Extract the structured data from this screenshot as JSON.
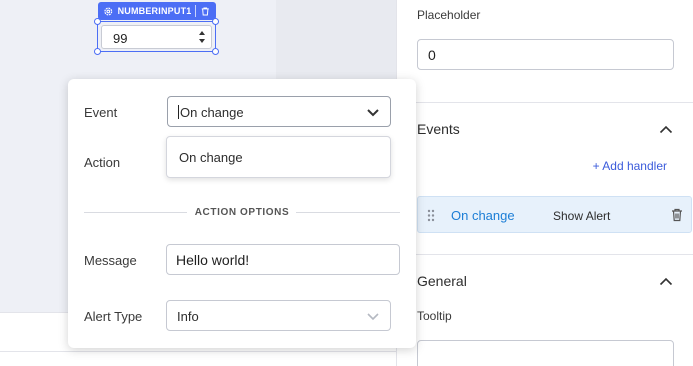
{
  "widget": {
    "name": "NUMBERINPUT1",
    "value": "99"
  },
  "popover": {
    "event_label": "Event",
    "event_value": "On change",
    "action_label": "Action",
    "dropdown_options": [
      "On change"
    ],
    "section_title": "ACTION OPTIONS",
    "message_label": "Message",
    "message_value": "Hello world!",
    "alert_type_label": "Alert Type",
    "alert_type_value": "Info"
  },
  "panel": {
    "placeholder_label": "Placeholder",
    "placeholder_value": "0",
    "events_title": "Events",
    "add_handler": "+ Add handler",
    "handlers": [
      {
        "event": "On change",
        "action": "Show Alert"
      }
    ],
    "general_title": "General",
    "tooltip_label": "Tooltip",
    "tooltip_value": ""
  },
  "colors": {
    "accent": "#4c6ef5",
    "link": "#3b5bdb",
    "handler_bg": "#e7f1fb",
    "handler_event": "#1c7ed6"
  },
  "icons": [
    "gear-icon",
    "trash-icon",
    "spinner-arrows-icon",
    "chevron-down-icon",
    "chevron-up-icon",
    "drag-handle-icon"
  ]
}
